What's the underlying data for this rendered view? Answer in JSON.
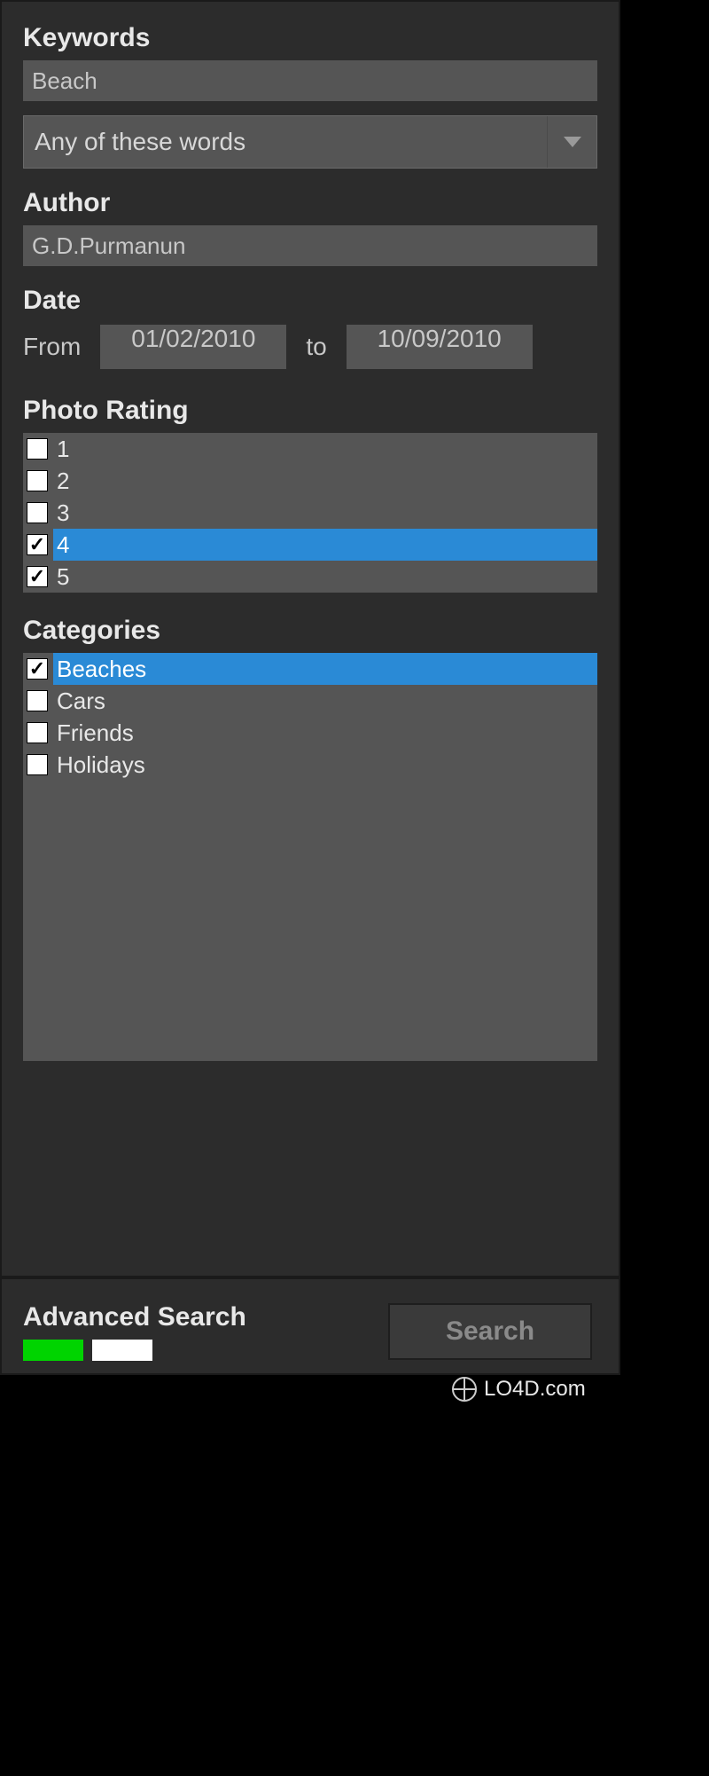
{
  "keywords": {
    "heading": "Keywords",
    "value": "Beach",
    "mode": "Any of these words"
  },
  "author": {
    "heading": "Author",
    "value": "G.D.Purmanun"
  },
  "date": {
    "heading": "Date",
    "from_label": "From",
    "to_label": "to",
    "from_value": "01/02/2010",
    "to_value": "10/09/2010"
  },
  "rating": {
    "heading": "Photo Rating",
    "items": [
      {
        "label": "1",
        "checked": false,
        "selected": false
      },
      {
        "label": "2",
        "checked": false,
        "selected": false
      },
      {
        "label": "3",
        "checked": false,
        "selected": false
      },
      {
        "label": "4",
        "checked": true,
        "selected": true
      },
      {
        "label": "5",
        "checked": true,
        "selected": false
      }
    ]
  },
  "categories": {
    "heading": "Categories",
    "items": [
      {
        "label": "Beaches",
        "checked": true,
        "selected": true
      },
      {
        "label": "Cars",
        "checked": false,
        "selected": false
      },
      {
        "label": "Friends",
        "checked": false,
        "selected": false
      },
      {
        "label": "Holidays",
        "checked": false,
        "selected": false
      }
    ]
  },
  "footer": {
    "advanced_label": "Advanced Search",
    "swatches": [
      "#00d400",
      "#ffffff"
    ],
    "search_label": "Search"
  },
  "watermark": "LO4D.com"
}
